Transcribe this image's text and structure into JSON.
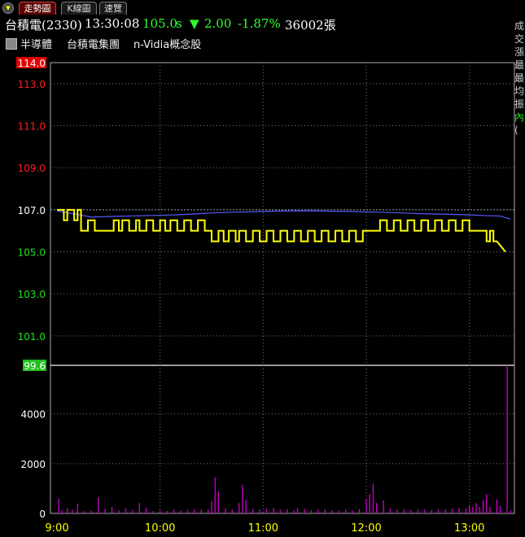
{
  "tabs": [
    {
      "label": "走勢圖",
      "active": true
    },
    {
      "label": "K線圖",
      "active": false
    },
    {
      "label": "速覽",
      "active": false
    }
  ],
  "info": {
    "stock": "台積電(2330)",
    "time": "13:30:08",
    "price": "105.0",
    "price_suffix": "s",
    "change_arrow": "▼",
    "change": "2.00",
    "change_pct": "-1.87%",
    "volume": "36002張"
  },
  "groups": [
    "半導體",
    "台積電集團",
    "n-Vidia概念股"
  ],
  "right_labels": [
    "成",
    "交",
    "漲",
    "最",
    "最",
    "均",
    "振",
    "內",
    "("
  ],
  "colors": {
    "price_line": "#ffff00",
    "avg_line": "#5a5aff",
    "volume_bars": "#d000d0",
    "up": "#ff2020",
    "down": "#20e020",
    "ref": "#ffffff"
  },
  "chart_data": {
    "type": "line",
    "price_axis": {
      "ticks": [
        "114.0",
        "113.0",
        "111.0",
        "109.0",
        "107.0",
        "105.0",
        "103.0",
        "101.0",
        "99.6"
      ],
      "values": [
        114.0,
        113.0,
        111.0,
        109.0,
        107.0,
        105.0,
        103.0,
        101.0,
        99.6
      ],
      "ylim": [
        99.6,
        114.0
      ],
      "reference": 107.0
    },
    "volume_axis": {
      "ticks": [
        "4000",
        "2000",
        "0"
      ],
      "values": [
        4000,
        2000,
        0
      ],
      "ylim": [
        0,
        5950
      ]
    },
    "time_ticks": [
      "9:00",
      "10:00",
      "11:00",
      "12:00",
      "13:00"
    ],
    "xlim_minutes": [
      0,
      270
    ],
    "price_series": [
      [
        0,
        107.0
      ],
      [
        3,
        107.0
      ],
      [
        4,
        106.5
      ],
      [
        6,
        107.0
      ],
      [
        10,
        106.5
      ],
      [
        12,
        107.0
      ],
      [
        14,
        106.0
      ],
      [
        16,
        106.0
      ],
      [
        18,
        106.5
      ],
      [
        22,
        106.0
      ],
      [
        30,
        106.0
      ],
      [
        33,
        106.5
      ],
      [
        36,
        106.0
      ],
      [
        38,
        106.5
      ],
      [
        42,
        106.0
      ],
      [
        46,
        106.5
      ],
      [
        48,
        106.0
      ],
      [
        52,
        106.5
      ],
      [
        56,
        106.0
      ],
      [
        60,
        106.5
      ],
      [
        63,
        106.0
      ],
      [
        66,
        106.5
      ],
      [
        70,
        106.0
      ],
      [
        74,
        106.5
      ],
      [
        78,
        106.0
      ],
      [
        82,
        106.5
      ],
      [
        86,
        106.0
      ],
      [
        88,
        106.0
      ],
      [
        90,
        105.5
      ],
      [
        94,
        106.0
      ],
      [
        97,
        105.5
      ],
      [
        100,
        106.0
      ],
      [
        104,
        105.5
      ],
      [
        106,
        106.0
      ],
      [
        110,
        105.5
      ],
      [
        114,
        106.0
      ],
      [
        118,
        105.5
      ],
      [
        122,
        106.0
      ],
      [
        126,
        105.5
      ],
      [
        130,
        106.0
      ],
      [
        134,
        105.5
      ],
      [
        138,
        106.0
      ],
      [
        142,
        105.5
      ],
      [
        146,
        106.0
      ],
      [
        150,
        105.5
      ],
      [
        154,
        106.0
      ],
      [
        158,
        105.5
      ],
      [
        162,
        106.0
      ],
      [
        166,
        105.5
      ],
      [
        170,
        106.0
      ],
      [
        174,
        105.5
      ],
      [
        178,
        106.0
      ],
      [
        182,
        106.0
      ],
      [
        185,
        106.0
      ],
      [
        188,
        106.5
      ],
      [
        192,
        106.0
      ],
      [
        196,
        106.5
      ],
      [
        200,
        106.0
      ],
      [
        204,
        106.5
      ],
      [
        208,
        106.0
      ],
      [
        212,
        106.5
      ],
      [
        216,
        106.0
      ],
      [
        220,
        106.5
      ],
      [
        224,
        106.0
      ],
      [
        228,
        106.5
      ],
      [
        232,
        106.0
      ],
      [
        236,
        106.5
      ],
      [
        240,
        106.0
      ],
      [
        244,
        106.0
      ],
      [
        247,
        106.0
      ],
      [
        250,
        105.5
      ],
      [
        252,
        106.0
      ],
      [
        254,
        105.5
      ],
      [
        256,
        105.5
      ],
      [
        261,
        105.0
      ]
    ],
    "avg_series": [
      [
        0,
        106.95
      ],
      [
        10,
        106.8
      ],
      [
        14,
        106.75
      ],
      [
        20,
        106.65
      ],
      [
        30,
        106.68
      ],
      [
        40,
        106.7
      ],
      [
        50,
        106.72
      ],
      [
        60,
        106.74
      ],
      [
        70,
        106.76
      ],
      [
        80,
        106.8
      ],
      [
        90,
        106.85
      ],
      [
        100,
        106.88
      ],
      [
        110,
        106.9
      ],
      [
        120,
        106.92
      ],
      [
        130,
        106.94
      ],
      [
        140,
        106.95
      ],
      [
        150,
        106.95
      ],
      [
        160,
        106.93
      ],
      [
        170,
        106.92
      ],
      [
        180,
        106.9
      ],
      [
        190,
        106.88
      ],
      [
        200,
        106.85
      ],
      [
        210,
        106.82
      ],
      [
        220,
        106.8
      ],
      [
        230,
        106.78
      ],
      [
        240,
        106.76
      ],
      [
        250,
        106.72
      ],
      [
        258,
        106.7
      ],
      [
        264,
        106.55
      ]
    ],
    "volume_series": [
      [
        1,
        580
      ],
      [
        3,
        120
      ],
      [
        6,
        200
      ],
      [
        9,
        150
      ],
      [
        12,
        400
      ],
      [
        16,
        90
      ],
      [
        20,
        110
      ],
      [
        24,
        650
      ],
      [
        28,
        180
      ],
      [
        32,
        260
      ],
      [
        36,
        120
      ],
      [
        40,
        200
      ],
      [
        44,
        140
      ],
      [
        48,
        420
      ],
      [
        52,
        230
      ],
      [
        56,
        90
      ],
      [
        60,
        120
      ],
      [
        64,
        100
      ],
      [
        68,
        160
      ],
      [
        72,
        110
      ],
      [
        76,
        140
      ],
      [
        80,
        180
      ],
      [
        84,
        160
      ],
      [
        88,
        140
      ],
      [
        90,
        500
      ],
      [
        92,
        1450
      ],
      [
        94,
        880
      ],
      [
        98,
        200
      ],
      [
        102,
        150
      ],
      [
        106,
        420
      ],
      [
        108,
        1150
      ],
      [
        110,
        520
      ],
      [
        114,
        180
      ],
      [
        118,
        160
      ],
      [
        122,
        190
      ],
      [
        126,
        210
      ],
      [
        130,
        150
      ],
      [
        134,
        170
      ],
      [
        138,
        120
      ],
      [
        140,
        220
      ],
      [
        144,
        190
      ],
      [
        148,
        130
      ],
      [
        152,
        150
      ],
      [
        156,
        170
      ],
      [
        160,
        130
      ],
      [
        164,
        110
      ],
      [
        168,
        150
      ],
      [
        172,
        120
      ],
      [
        176,
        180
      ],
      [
        180,
        580
      ],
      [
        182,
        780
      ],
      [
        184,
        1190
      ],
      [
        186,
        420
      ],
      [
        190,
        520
      ],
      [
        194,
        200
      ],
      [
        198,
        150
      ],
      [
        202,
        180
      ],
      [
        206,
        140
      ],
      [
        210,
        150
      ],
      [
        214,
        160
      ],
      [
        218,
        130
      ],
      [
        222,
        150
      ],
      [
        226,
        170
      ],
      [
        230,
        190
      ],
      [
        234,
        220
      ],
      [
        238,
        200
      ],
      [
        240,
        300
      ],
      [
        242,
        260
      ],
      [
        244,
        420
      ],
      [
        246,
        260
      ],
      [
        248,
        520
      ],
      [
        250,
        780
      ],
      [
        252,
        260
      ],
      [
        256,
        560
      ],
      [
        258,
        300
      ],
      [
        262,
        5950
      ],
      [
        264,
        120
      ]
    ]
  }
}
